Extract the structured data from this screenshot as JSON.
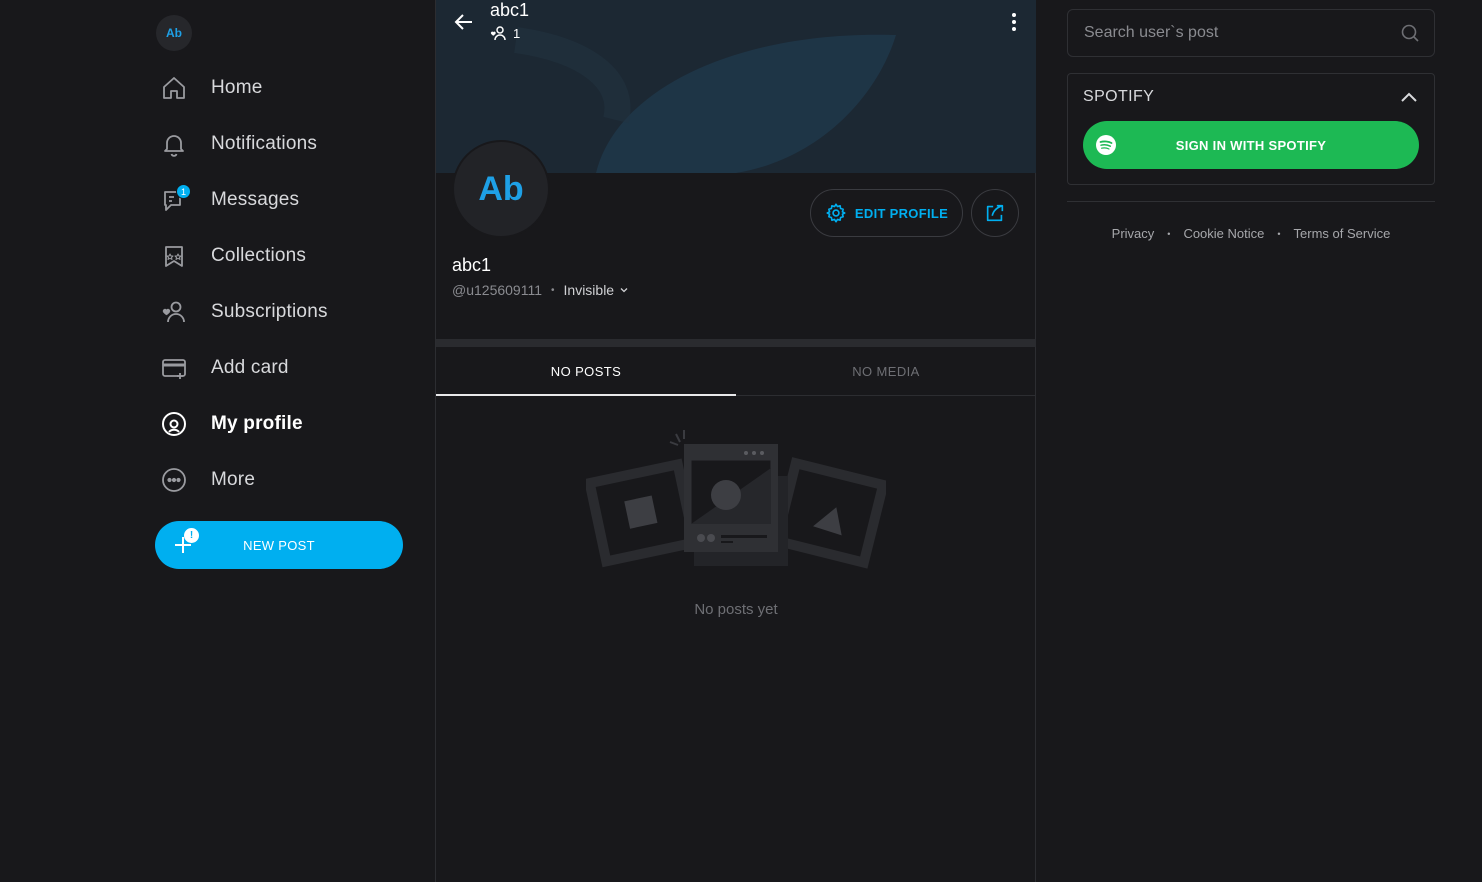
{
  "sidebar": {
    "avatar_initials": "Ab",
    "items": [
      {
        "label": "Home",
        "icon": "home-icon"
      },
      {
        "label": "Notifications",
        "icon": "bell-icon"
      },
      {
        "label": "Messages",
        "icon": "messages-icon",
        "badge": "1"
      },
      {
        "label": "Collections",
        "icon": "collections-icon"
      },
      {
        "label": "Subscriptions",
        "icon": "subscriptions-icon"
      },
      {
        "label": "Add card",
        "icon": "add-card-icon"
      },
      {
        "label": "My profile",
        "icon": "profile-icon",
        "active": true
      },
      {
        "label": "More",
        "icon": "more-icon"
      }
    ],
    "new_post": {
      "label": "NEW POST",
      "alert": "!"
    }
  },
  "profile": {
    "header_name": "abc1",
    "subscriber_count": "1",
    "avatar_initials": "Ab",
    "edit_label": "EDIT PROFILE",
    "name": "abc1",
    "handle": "@u125609111",
    "separator": "•",
    "status": "Invisible"
  },
  "tabs": [
    {
      "label": "NO POSTS",
      "active": true
    },
    {
      "label": "NO MEDIA",
      "active": false
    }
  ],
  "empty": {
    "text": "No posts yet"
  },
  "search": {
    "placeholder": "Search user`s post"
  },
  "spotify": {
    "title": "SPOTIFY",
    "button_label": "SIGN IN WITH SPOTIFY"
  },
  "footer": {
    "links": [
      "Privacy",
      "Cookie Notice",
      "Terms of Service"
    ],
    "separator": "•"
  },
  "colors": {
    "accent": "#00aff0",
    "spotify": "#1db954",
    "background": "#18181b"
  }
}
